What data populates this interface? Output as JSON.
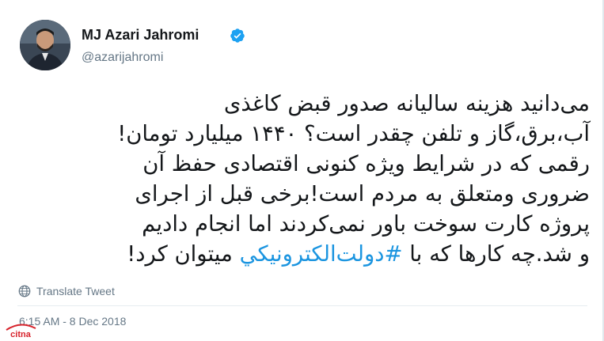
{
  "user": {
    "name": "MJ Azari Jahromi",
    "handle": "@azarijahromi"
  },
  "tweet": {
    "lines": [
      "می‌دانید هزینه سالیانه صدور قبض کاغذی",
      "آب،برق،گاز و تلفن چقدر است؟ ۱۴۴۰ میلیارد تومان!",
      "رقمی که در شرایط ویژه کنونی اقتصادی حفظ آن",
      "ضروری ومتعلق به مردم  است!برخی قبل از اجرای",
      "پروژه کارت سوخت باور نمی‌کردند اما انجام دادیم"
    ],
    "last_line_before_hashtag": "و شد.چه کارها که با ",
    "hashtag": "#دولت‌الكترونيكي",
    "last_line_after_hashtag": " میتوان کرد!"
  },
  "translate_label": "Translate Tweet",
  "timestamp": "6:15 AM - 8 Dec 2018",
  "watermark": {
    "text": "citna"
  },
  "colors": {
    "hashtag": "#1b95e0",
    "verified": "#1da1f2",
    "secondary_text": "#657786",
    "watermark": "#d7222b"
  }
}
